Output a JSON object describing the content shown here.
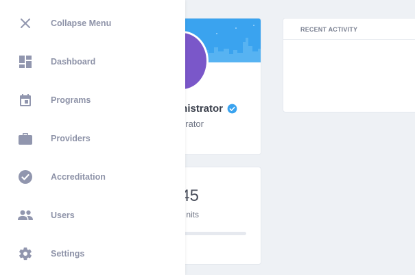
{
  "menu": {
    "items": [
      {
        "label": "Collapse Menu",
        "icon": "close-icon"
      },
      {
        "label": "Dashboard",
        "icon": "dashboard-icon"
      },
      {
        "label": "Programs",
        "icon": "calendar-icon"
      },
      {
        "label": "Providers",
        "icon": "briefcase-icon"
      },
      {
        "label": "Accreditation",
        "icon": "check-circle-icon"
      },
      {
        "label": "Users",
        "icon": "users-icon"
      },
      {
        "label": "Settings",
        "icon": "gear-icon"
      }
    ],
    "icon_color": "#9196ae",
    "text_color": "#8e93a8"
  },
  "profile": {
    "name": "nistrator",
    "role": "rator",
    "avatar_color": "#7a57c9",
    "banner_color": "#3aa3ef"
  },
  "units": {
    "value": "45",
    "label": "nits",
    "progress": 0
  },
  "activity": {
    "header": "RECENT ACTIVITY"
  },
  "colors": {
    "background": "#eef1f5",
    "verified": "#3aa3ef"
  }
}
